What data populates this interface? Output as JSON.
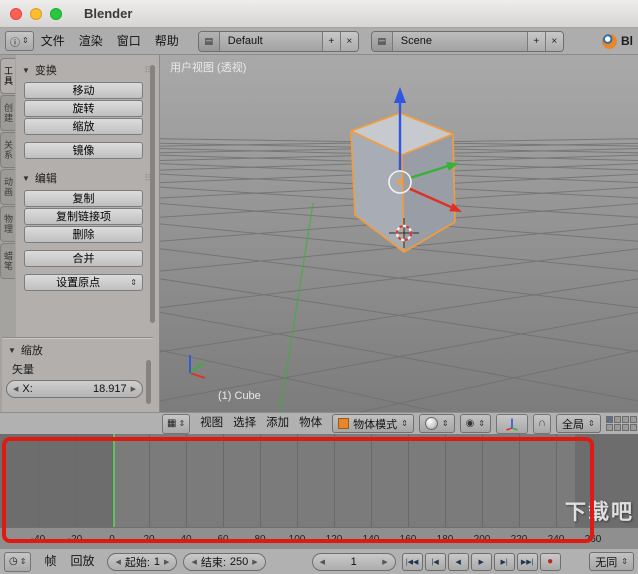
{
  "window": {
    "title": "Blender"
  },
  "icons": {
    "info": "ⓘ",
    "editor_3d": "▦",
    "editor_timeline": "◷",
    "dropdown_arrows": "⇕",
    "collapse_caret": "▼",
    "drag_dots": "⠿",
    "add": "+",
    "close": "×",
    "browse": "▤",
    "slider_left": "◀",
    "slider_right": "▶",
    "pivot": "◉",
    "magnet": "∩"
  },
  "colors": {
    "accent_orange": "#e8872a",
    "selection_outline": "#f49c38",
    "current_frame_green": "#5fc25f",
    "annotation_red": "#de1a12",
    "axis_x": "#e03024",
    "axis_y": "#36b236",
    "axis_z": "#3056e0"
  },
  "info_header": {
    "menus": [
      {
        "id": "file",
        "label": "文件"
      },
      {
        "id": "render",
        "label": "渲染"
      },
      {
        "id": "window",
        "label": "窗口"
      },
      {
        "id": "help",
        "label": "帮助"
      }
    ],
    "layout_value": "Default",
    "scene_value": "Scene",
    "right_text": "Bl"
  },
  "tool_shelf": {
    "tabs": [
      {
        "id": "tools",
        "label": "工具",
        "active": true
      },
      {
        "id": "create",
        "label": "创建"
      },
      {
        "id": "relations",
        "label": "关系"
      },
      {
        "id": "animation",
        "label": "动画"
      },
      {
        "id": "physics",
        "label": "物理"
      },
      {
        "id": "grease-pencil",
        "label": "蜡笔"
      }
    ],
    "panels": [
      {
        "id": "transform",
        "title": "变换",
        "groups": [
          [
            "移动",
            "旋转",
            "缩放"
          ],
          [
            "镜像"
          ]
        ]
      },
      {
        "id": "edit",
        "title": "编辑",
        "groups": [
          [
            "复制",
            "复制链接项",
            "删除"
          ],
          [
            "合并"
          ]
        ],
        "dropdown": "设置原点"
      }
    ],
    "operator_panel": {
      "title": "缩放",
      "vector_label": "矢量",
      "x_label": "X:",
      "x_value": "18.917"
    }
  },
  "viewport": {
    "view_label": "用户视图 (透视)",
    "object_label": "(1) Cube",
    "header": {
      "menus": [
        {
          "id": "view",
          "label": "视图"
        },
        {
          "id": "select",
          "label": "选择"
        },
        {
          "id": "add",
          "label": "添加"
        },
        {
          "id": "object",
          "label": "物体"
        }
      ],
      "mode_value": "物体模式",
      "orientation_value": "全局",
      "layers": {
        "groups": 2,
        "rows": 2,
        "cols": 5
      }
    }
  },
  "timeline": {
    "ticks": [
      -40,
      -20,
      0,
      20,
      40,
      60,
      80,
      100,
      120,
      140,
      160,
      180,
      200,
      220,
      240,
      260
    ],
    "current_frame": 1,
    "header": {
      "menus": [
        {
          "id": "frame",
          "label": "帧"
        },
        {
          "id": "playback",
          "label": "回放"
        }
      ],
      "start_label": "起始:",
      "start_value": "1",
      "end_label": "结束:",
      "end_value": "250",
      "frame_value": "1",
      "playback": [
        {
          "name": "jump-to-start-button",
          "glyph": "|◀◀"
        },
        {
          "name": "prev-keyframe-button",
          "glyph": "|◀"
        },
        {
          "name": "play-reverse-button",
          "glyph": "◀"
        },
        {
          "name": "play-button",
          "glyph": "▶"
        },
        {
          "name": "next-keyframe-button",
          "glyph": "▶|"
        },
        {
          "name": "jump-to-end-button",
          "glyph": "▶▶|"
        },
        {
          "name": "record-button",
          "glyph": "●",
          "record": true
        }
      ],
      "sync_value": "无同"
    }
  },
  "watermark": "下载吧"
}
